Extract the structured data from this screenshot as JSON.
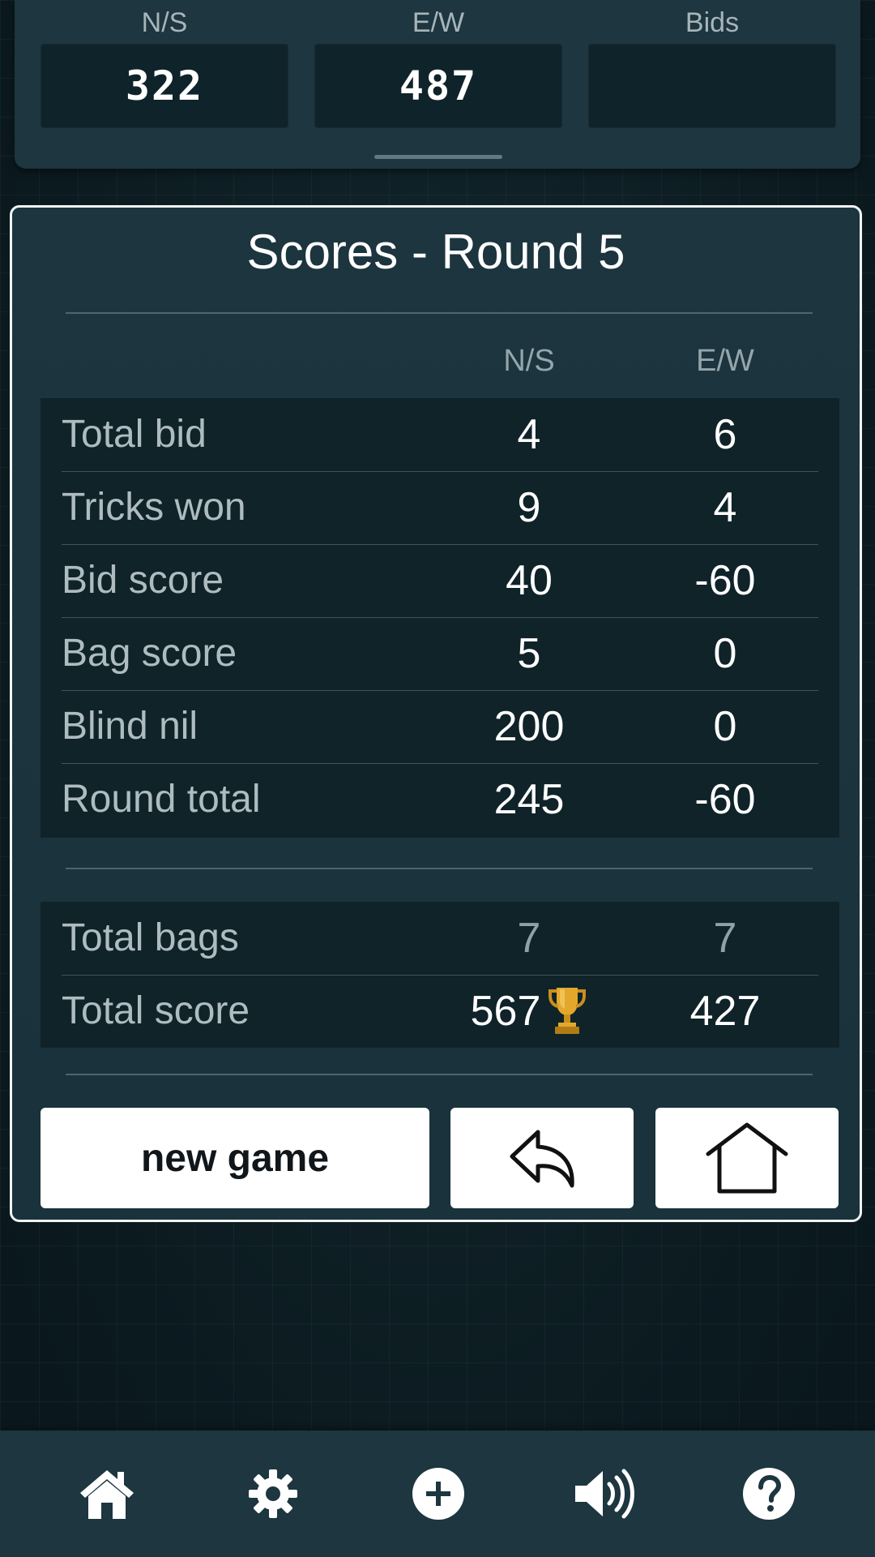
{
  "top_panel": {
    "columns": [
      {
        "label": "N/S",
        "value": "322"
      },
      {
        "label": "E/W",
        "value": "487"
      },
      {
        "label": "Bids",
        "value": ""
      }
    ]
  },
  "dialog": {
    "title": "Scores - Round 5",
    "column_headers": {
      "ns": "N/S",
      "ew": "E/W"
    },
    "round_rows": [
      {
        "label": "Total bid",
        "ns": "4",
        "ew": "6"
      },
      {
        "label": "Tricks won",
        "ns": "9",
        "ew": "4"
      },
      {
        "label": "Bid score",
        "ns": "40",
        "ew": "-60"
      },
      {
        "label": "Bag score",
        "ns": "5",
        "ew": "0"
      },
      {
        "label": "Blind nil",
        "ns": "200",
        "ew": "0"
      },
      {
        "label": "Round total",
        "ns": "245",
        "ew": "-60"
      }
    ],
    "total_rows": [
      {
        "label": "Total bags",
        "ns": "7",
        "ew": "7"
      },
      {
        "label": "Total score",
        "ns": "567",
        "ew": "427",
        "winner": "ns"
      }
    ],
    "buttons": {
      "new_game": "new game",
      "back_icon": "reply-arrow-icon",
      "home_icon": "house-outline-icon"
    }
  },
  "bottom_nav": {
    "items": [
      "home-icon",
      "gear-icon",
      "plus-circle-icon",
      "speaker-icon",
      "help-icon"
    ]
  },
  "colors": {
    "background": "#0c1d23",
    "panel": "#1d3640",
    "table": "#0f2329",
    "label": "#aebcc0",
    "trophy": "#e3a82b"
  }
}
